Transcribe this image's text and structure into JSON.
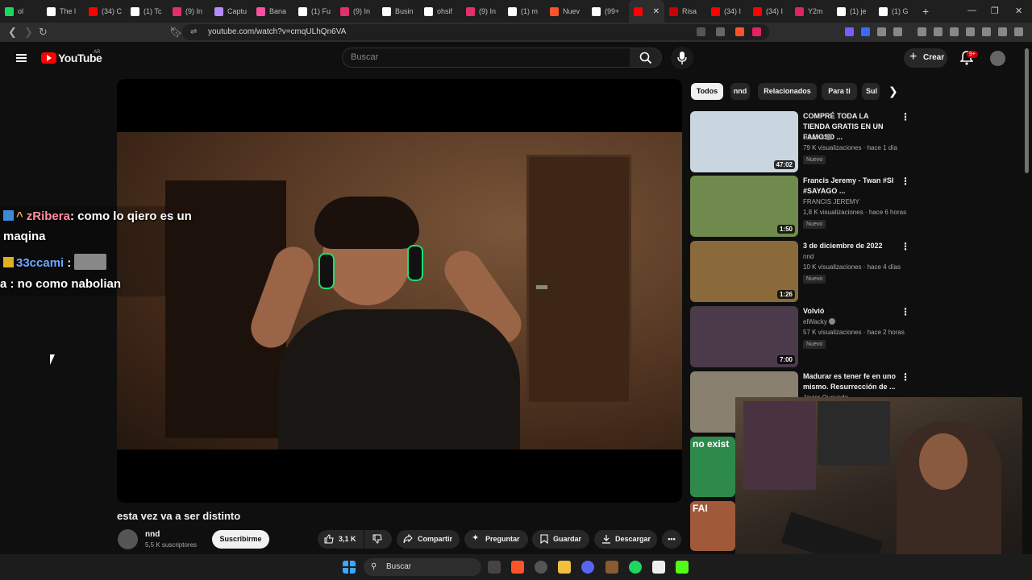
{
  "browser": {
    "tabs": [
      {
        "label": "ol",
        "icon": "green-app-icon",
        "color": "#1ed760"
      },
      {
        "label": "The l",
        "icon": "threads-icon",
        "color": "#ffffff"
      },
      {
        "label": "(34) C",
        "icon": "youtube-icon",
        "color": "#ff0000"
      },
      {
        "label": "(1) Tc",
        "icon": "x-icon",
        "color": "#ffffff"
      },
      {
        "label": "(9) In",
        "icon": "instagram-icon",
        "color": "#e1306c"
      },
      {
        "label": "Captu",
        "icon": "pen-icon",
        "color": "#b48cff"
      },
      {
        "label": "Bana",
        "icon": "sparkle-icon",
        "color": "#ff4fa3"
      },
      {
        "label": "(1) Fu",
        "icon": "x-icon",
        "color": "#ffffff"
      },
      {
        "label": "(9) In",
        "icon": "instagram-icon",
        "color": "#e1306c"
      },
      {
        "label": "Busin",
        "icon": "tiktok-icon",
        "color": "#ffffff"
      },
      {
        "label": "ohsif",
        "icon": "tiktok-icon",
        "color": "#ffffff"
      },
      {
        "label": "(9) In",
        "icon": "instagram-icon",
        "color": "#e1306c"
      },
      {
        "label": "(1) m",
        "icon": "x-icon",
        "color": "#ffffff"
      },
      {
        "label": "Nuev",
        "icon": "brave-icon",
        "color": "#fb542b"
      },
      {
        "label": "(99+",
        "icon": "tiktok-icon",
        "color": "#ffffff"
      }
    ],
    "active_tab_icon": "youtube-icon",
    "tabs_after": [
      {
        "label": "Risa",
        "icon": "red-circle-icon",
        "color": "#cc0000"
      },
      {
        "label": "(34) I",
        "icon": "youtube-icon",
        "color": "#ff0000"
      },
      {
        "label": "(34) I",
        "icon": "youtube-icon",
        "color": "#ff0000"
      },
      {
        "label": "Y2m",
        "icon": "y2mate-icon",
        "color": "#e0245e"
      },
      {
        "label": "(1) je",
        "icon": "x-icon",
        "color": "#ffffff"
      },
      {
        "label": "(1) G",
        "icon": "x-icon",
        "color": "#ffffff"
      }
    ],
    "new_tab": "+",
    "url": "youtube.com/watch?v=cmqULhQn6VA"
  },
  "header": {
    "logo_text": "YouTube",
    "country": "AR",
    "search_placeholder": "Buscar",
    "create_label": "Crear",
    "notifications_badge": "9+"
  },
  "chat": {
    "lines": [
      {
        "user": "zRibera",
        "user_color": "#ff8fa3",
        "text": ": como lo qiero es un"
      },
      {
        "text": "maqina"
      },
      {
        "user": "33ccami",
        "user_color": "#6fa8ff",
        "text": " :"
      },
      {
        "text": "a : no como nabolian"
      }
    ]
  },
  "video": {
    "title": "esta vez va a ser distinto",
    "channel": "nnd",
    "subscribers": "5,5 K suscriptores",
    "subscribe_label": "Suscribirme",
    "likes": "3,1 K",
    "share_label": "Compartir",
    "ask_label": "Preguntar",
    "save_label": "Guardar",
    "download_label": "Descargar"
  },
  "chips": [
    "Todos",
    "nnd",
    "Relacionados",
    "Para ti",
    "Sul"
  ],
  "recommendations": [
    {
      "title": "COMPRÉ TODA LA TIENDA GRATIS EN UN FAMOSO ...",
      "channel": "SSamu",
      "verified": true,
      "meta": "79 K visualizaciones · hace 1 día",
      "badge": "Nuevo",
      "duration": "47:02",
      "thumb_color": "#c9d6e0"
    },
    {
      "title": "Francis Jeremy - Twan #SI #SAYAGO ...",
      "channel": "FRANCIS JEREMY",
      "verified": false,
      "meta": "1,8 K visualizaciones · hace 6 horas",
      "badge": "Nuevo",
      "duration": "1:50",
      "thumb_color": "#6f8a4c"
    },
    {
      "title": "3 de diciembre de 2022",
      "channel": "nnd",
      "verified": false,
      "meta": "10 K visualizaciones · hace 4 días",
      "badge": "Nuevo",
      "duration": "1:26",
      "thumb_color": "#8a6a3a"
    },
    {
      "title": "Volvió",
      "channel": "elWacky",
      "verified": true,
      "meta": "57 K visualizaciones · hace 2 horas",
      "badge": "Nuevo",
      "duration": "7:00",
      "thumb_color": "#4a3a4a"
    },
    {
      "title": "Madurar es tener fe en uno mismo. Resurrección de ...",
      "channel": "Javier Quevedo",
      "verified": false,
      "meta": "",
      "badge": "",
      "duration": "",
      "thumb_color": "#8a8070"
    }
  ],
  "rec_partial": [
    {
      "overlay_text": "no exist",
      "thumb_color": "#2e8a4a"
    },
    {
      "overlay_text": "FAI",
      "thumb_color": "#a05a3a"
    }
  ],
  "taskbar": {
    "search_placeholder": "Buscar"
  }
}
